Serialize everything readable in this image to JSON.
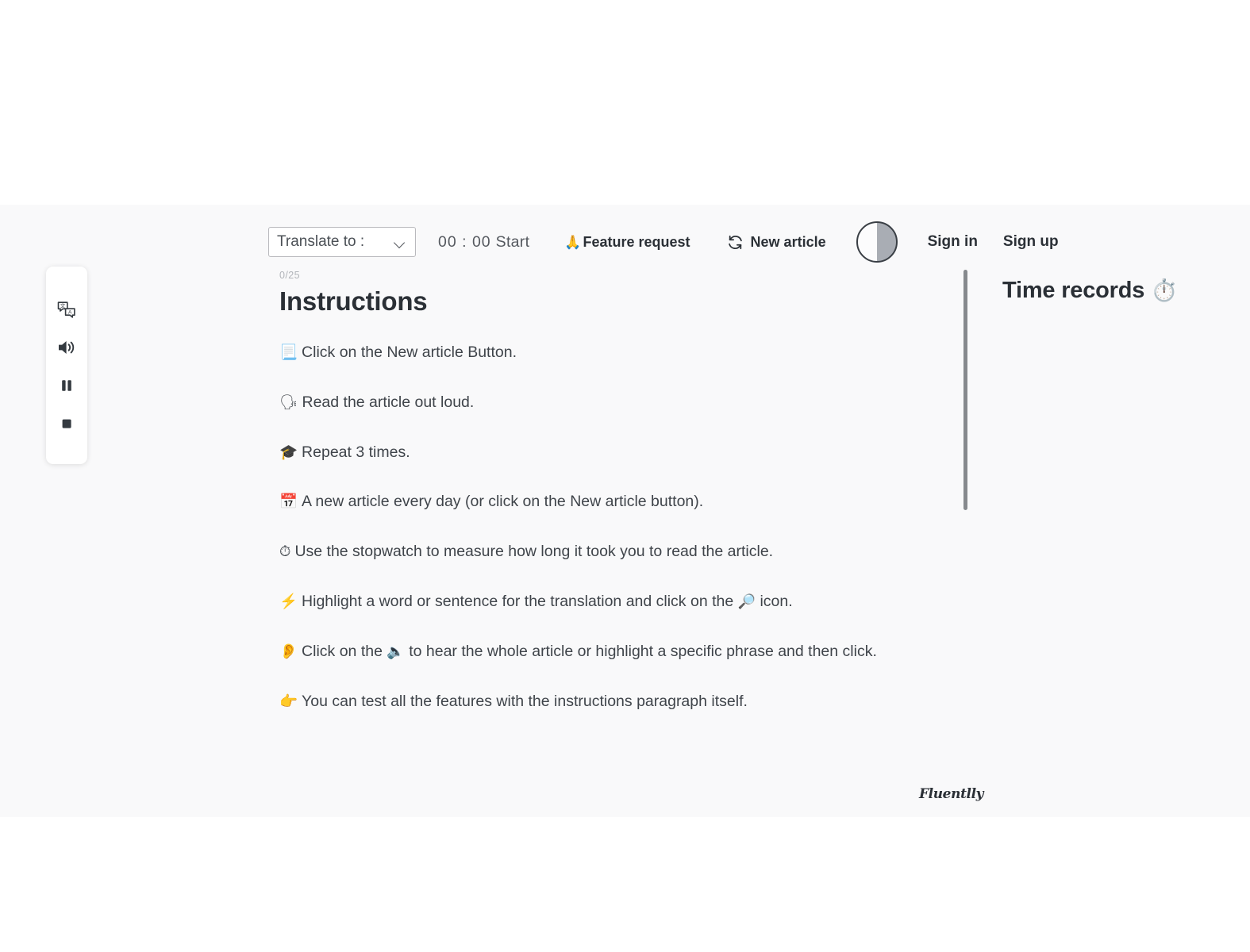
{
  "app": {
    "brand": "Fluentlly",
    "background_color": "#f9f9fa",
    "page_color": "#ffffff",
    "text_color": "#3f444a",
    "heading_color": "#2b3036"
  },
  "header": {
    "translate_select": {
      "selected": "Translate to :",
      "options": [
        "Translate to :"
      ],
      "chevron_icon": "chevron-down-icon"
    },
    "timer": {
      "value": "00 : 00",
      "start_label": "Start"
    },
    "feature_request": {
      "emoji": "🙏",
      "label": "Feature request"
    },
    "new_article": {
      "icon": "sync-icon",
      "label": "New article"
    },
    "theme_toggle": {
      "icon": "half-circle-icon",
      "state": "light"
    },
    "sign_in": "Sign in",
    "sign_up": "Sign up"
  },
  "sidebar": {
    "tools": [
      {
        "icon": "translate-icon",
        "name": "translate"
      },
      {
        "icon": "volume-icon",
        "name": "read-aloud"
      },
      {
        "icon": "pause-icon",
        "name": "pause"
      },
      {
        "icon": "stop-icon",
        "name": "stop"
      }
    ]
  },
  "article": {
    "counter": "0/25",
    "title": "Instructions",
    "instructions": [
      {
        "emoji": "📃",
        "text": "Click on the New article Button."
      },
      {
        "emoji": "🗣",
        "text": "Read the article out loud."
      },
      {
        "emoji": "🎓",
        "text": "Repeat 3 times."
      },
      {
        "emoji": "📅",
        "text": "A new article every day (or click on the New article button)."
      },
      {
        "emoji": "⏱",
        "text": "Use the stopwatch to measure how long it took you to read the article."
      },
      {
        "emoji": "⚡",
        "text_before": "Highlight a word or sentence for the translation and click on the ",
        "inline_emoji": "🔎",
        "text_after": " icon."
      },
      {
        "emoji": "👂",
        "text_before": "Click on the ",
        "inline_emoji": "🔈",
        "text_after": " to hear the whole article or highlight a specific phrase and then click."
      },
      {
        "emoji": "👉",
        "text": "You can test all the features with the instructions paragraph itself."
      }
    ]
  },
  "records": {
    "title": "Time records",
    "emoji": "⏱️",
    "divider_color": "#86898d"
  }
}
